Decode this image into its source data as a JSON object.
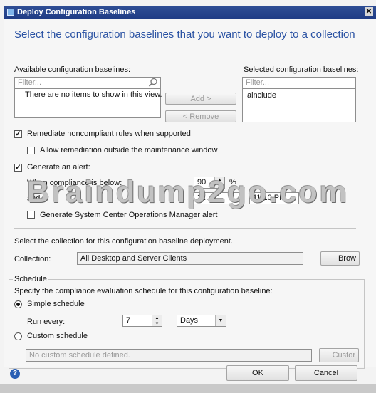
{
  "window": {
    "title": "Deploy Configuration Baselines"
  },
  "heading": "Select the configuration baselines that you want to deploy to a collection",
  "available": {
    "label": "Available configuration baselines:",
    "filter_placeholder": "Filter...",
    "empty_text": "There are no items to show in this view."
  },
  "selected": {
    "label": "Selected configuration baselines:",
    "filter_placeholder": "Filter...",
    "items": [
      "ainclude"
    ]
  },
  "buttons": {
    "add": "Add >",
    "remove": "< Remove",
    "browse": "Brow",
    "custom": "Custor",
    "ok": "OK",
    "cancel": "Cancel"
  },
  "options": {
    "remediate": {
      "label": "Remediate noncompliant rules when supported",
      "checked": true
    },
    "allow_outside": {
      "label": "Allow remediation outside the maintenance window",
      "checked": false
    },
    "alert": {
      "label": "Generate an alert:",
      "checked": true
    },
    "compliance_label": "When compliance is below:",
    "compliance_value": "90",
    "compliance_unit": "%",
    "date_label": "and d",
    "date_value": "2 ...",
    "time_value": "11:10 PM",
    "scom": {
      "label": "Generate System Center Operations Manager alert",
      "checked": false
    }
  },
  "collection": {
    "instruction": "Select the collection for this configuration baseline deployment.",
    "label": "Collection:",
    "value": "All Desktop and Server Clients"
  },
  "schedule": {
    "group_label": "Schedule",
    "instruction": "Specify the compliance evaluation schedule for this configuration baseline:",
    "simple": {
      "label": "Simple schedule",
      "selected": true
    },
    "run_every_label": "Run every:",
    "run_every_value": "7",
    "unit": "Days",
    "custom": {
      "label": "Custom schedule",
      "selected": false
    },
    "custom_text": "No custom schedule defined."
  },
  "watermark": "Braindump2go.com",
  "icons": {
    "search": "magnifier-icon",
    "help": "help-icon"
  }
}
